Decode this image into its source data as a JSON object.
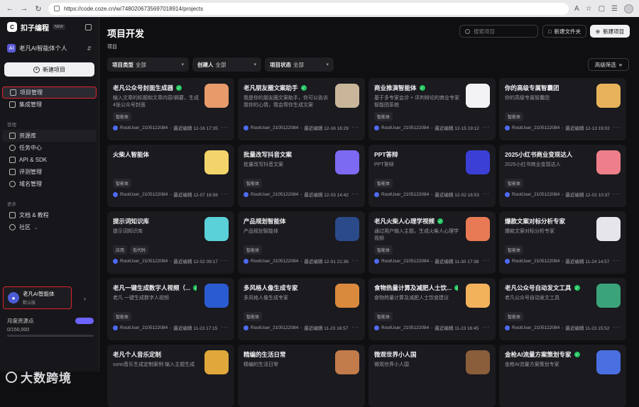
{
  "browser": {
    "url": "https://code.coze.cn/w/7480206735697018914/projects"
  },
  "sidebar": {
    "brand": "扣子编程",
    "badge": "NEW",
    "workspace": "老凡AI智能体个人",
    "create_label": "新建项目",
    "items_top": [
      {
        "label": "项目管理",
        "icon": "folder-icon"
      },
      {
        "label": "集成管理",
        "icon": "plug-icon"
      }
    ],
    "section_manage": "管理",
    "items_manage": [
      {
        "label": "资源库",
        "icon": "library-icon"
      },
      {
        "label": "任务中心",
        "icon": "task-icon"
      },
      {
        "label": "API & SDK",
        "icon": "api-icon"
      },
      {
        "label": "评测管理",
        "icon": "eval-icon"
      },
      {
        "label": "域名管理",
        "icon": "domain-icon"
      }
    ],
    "section_more": "更多",
    "items_more": [
      {
        "label": "文档 & 教程",
        "icon": "doc-icon"
      },
      {
        "label": "社区",
        "icon": "community-icon"
      }
    ],
    "account": {
      "name": "老凡AI智能体",
      "plan": "默认版"
    },
    "quota": {
      "label": "月度资源点",
      "value": "0/150,000",
      "used_fraction": 0
    }
  },
  "main": {
    "title": "项目开发",
    "subtitle": "项目",
    "search_placeholder": "搜索项目",
    "new_folder": "新建文件夹",
    "new_project": "新建项目",
    "filters": [
      {
        "name": "项目类型",
        "value": "全部"
      },
      {
        "name": "创建人",
        "value": "全部"
      },
      {
        "name": "项目状态",
        "value": "全部"
      }
    ],
    "advanced_filter": "高级筛选",
    "cards": [
      {
        "title": "老凡公众号封面生成器",
        "published": true,
        "desc": "输入文章的标题和文章内容/摘要，生成4张公众号封面",
        "tags": [
          "智能体"
        ],
        "user": "RootUser_2105122084",
        "edited": "最近编辑 12-16 17:35",
        "thumb": "#e79a6a"
      },
      {
        "title": "老凡朋友圈文案助手",
        "published": true,
        "desc": "我是你的朋友圈文案助手，你可以告诉我你的心情，我会帮你生成文案",
        "tags": [],
        "user": "RootUser_2105122084",
        "edited": "最近编辑 12-16 16:29",
        "thumb": "#c9b69a"
      },
      {
        "title": "商业推演智能体",
        "published": true,
        "desc": "基于多专家会诊 + 评判辩论的商业专家智能团系统",
        "tags": [
          "智能体"
        ],
        "user": "RootUser_2105122084",
        "edited": "最近编辑 12-15 19:12",
        "thumb": "#f3f3f6"
      },
      {
        "title": "你的高级专属智囊团",
        "published": false,
        "desc": "你的高级专属智囊团",
        "tags": [
          "智能体"
        ],
        "user": "RootUser_2105122084",
        "edited": "最近编辑 12-13 19:02",
        "thumb": "#e8b25a"
      },
      {
        "title": "火柴人智能体",
        "published": false,
        "desc": "",
        "tags": [
          "智能体"
        ],
        "user": "RootUser_2105122084",
        "edited": "最近编辑 12-07 16:56",
        "thumb": "#f3d46a"
      },
      {
        "title": "批量改写抖音文案",
        "published": false,
        "desc": "批量改写抖音文案",
        "tags": [
          "智能体"
        ],
        "user": "RootUser_2105122084",
        "edited": "最近编辑 12-03 14:42",
        "thumb": "#7c6af2"
      },
      {
        "title": "PPT答辩",
        "published": false,
        "desc": "PPT答辩",
        "tags": [
          "智能体"
        ],
        "user": "RootUser_2105122084",
        "edited": "最近编辑 12-02 16:53",
        "thumb": "#3b3fd6"
      },
      {
        "title": "2025小红书商业变现达人",
        "published": false,
        "desc": "2025小红书商业变现达人",
        "tags": [
          "智能体"
        ],
        "user": "RootUser_2105122084",
        "edited": "最近编辑 12-02 10:37",
        "thumb": "#ee7f8a"
      },
      {
        "title": "提示词知识库",
        "published": false,
        "desc": "提示词知识库",
        "tags": [
          "应用",
          "低代码"
        ],
        "user": "RootUser_2105122084",
        "edited": "最近编辑 12-02 09:17",
        "thumb": "#5ad0d8"
      },
      {
        "title": "产品规划智能体",
        "published": false,
        "desc": "产品规划智能体",
        "tags": [
          "智能体"
        ],
        "user": "RootUser_2105122084",
        "edited": "最近编辑 12-01 21:36",
        "thumb": "#2a4a8a"
      },
      {
        "title": "老凡火柴人心理学视频",
        "published": true,
        "desc": "通过用户输入主题，生成火柴人心理学视频",
        "tags": [
          "智能体"
        ],
        "user": "RootUser_2105122084",
        "edited": "最近编辑 11-30 17:38",
        "thumb": "#e77a55"
      },
      {
        "title": "爆款文案对标分析专家",
        "published": false,
        "desc": "爆款文案对标分析专家",
        "tags": [
          "智能体"
        ],
        "user": "RootUser_2105122084",
        "edited": "最近编辑 11-24 14:57",
        "thumb": "#e6e6ea"
      },
      {
        "title": "老凡一键生成数字人视频（...",
        "published": true,
        "desc": "老凡 一键生成数字人视频",
        "tags": [
          "智能体"
        ],
        "user": "RootUser_2105122084",
        "edited": "最近编辑 11-23 17:15",
        "thumb": "#2b5bd0"
      },
      {
        "title": "多风格人像生成专家",
        "published": false,
        "desc": "多风格人像生成专家",
        "tags": [
          "智能体"
        ],
        "user": "RootUser_2105122084",
        "edited": "最近编辑 11-23 16:57",
        "thumb": "#d98a3c"
      },
      {
        "title": "食物热量计算及减肥人士饮...",
        "published": true,
        "desc": "食物热量计算及减肥人士饮食建议",
        "tags": [
          "智能体"
        ],
        "user": "RootUser_2105122084",
        "edited": "最近编辑 11-23 16:45",
        "thumb": "#f2b25c"
      },
      {
        "title": "老凡公众号自动发文工具",
        "published": true,
        "desc": "老凡公众号自动发文工具",
        "tags": [
          "智能体"
        ],
        "user": "RootUser_2105122084",
        "edited": "最近编辑 11-23 15:52",
        "thumb": "#3aa37a"
      },
      {
        "title": "老凡个人音乐定制",
        "published": false,
        "desc": "suno音乐生成定制案例 输入主题生成",
        "tags": [],
        "user": "",
        "edited": "",
        "thumb": "#e0a83a"
      },
      {
        "title": "精编的生活日常",
        "published": false,
        "desc": "精编的生活日常",
        "tags": [],
        "user": "",
        "edited": "",
        "thumb": "#c27b4b"
      },
      {
        "title": "微观世界小人国",
        "published": false,
        "desc": "微观世界小人国",
        "tags": [],
        "user": "",
        "edited": "",
        "thumb": "#8a5d3b"
      },
      {
        "title": "金枪AI流量方案策划专家",
        "published": true,
        "desc": "金枪AI流量方案策划专家",
        "tags": [],
        "user": "",
        "edited": "",
        "thumb": "#4a6fe0"
      }
    ]
  },
  "watermark": "大数跨境"
}
